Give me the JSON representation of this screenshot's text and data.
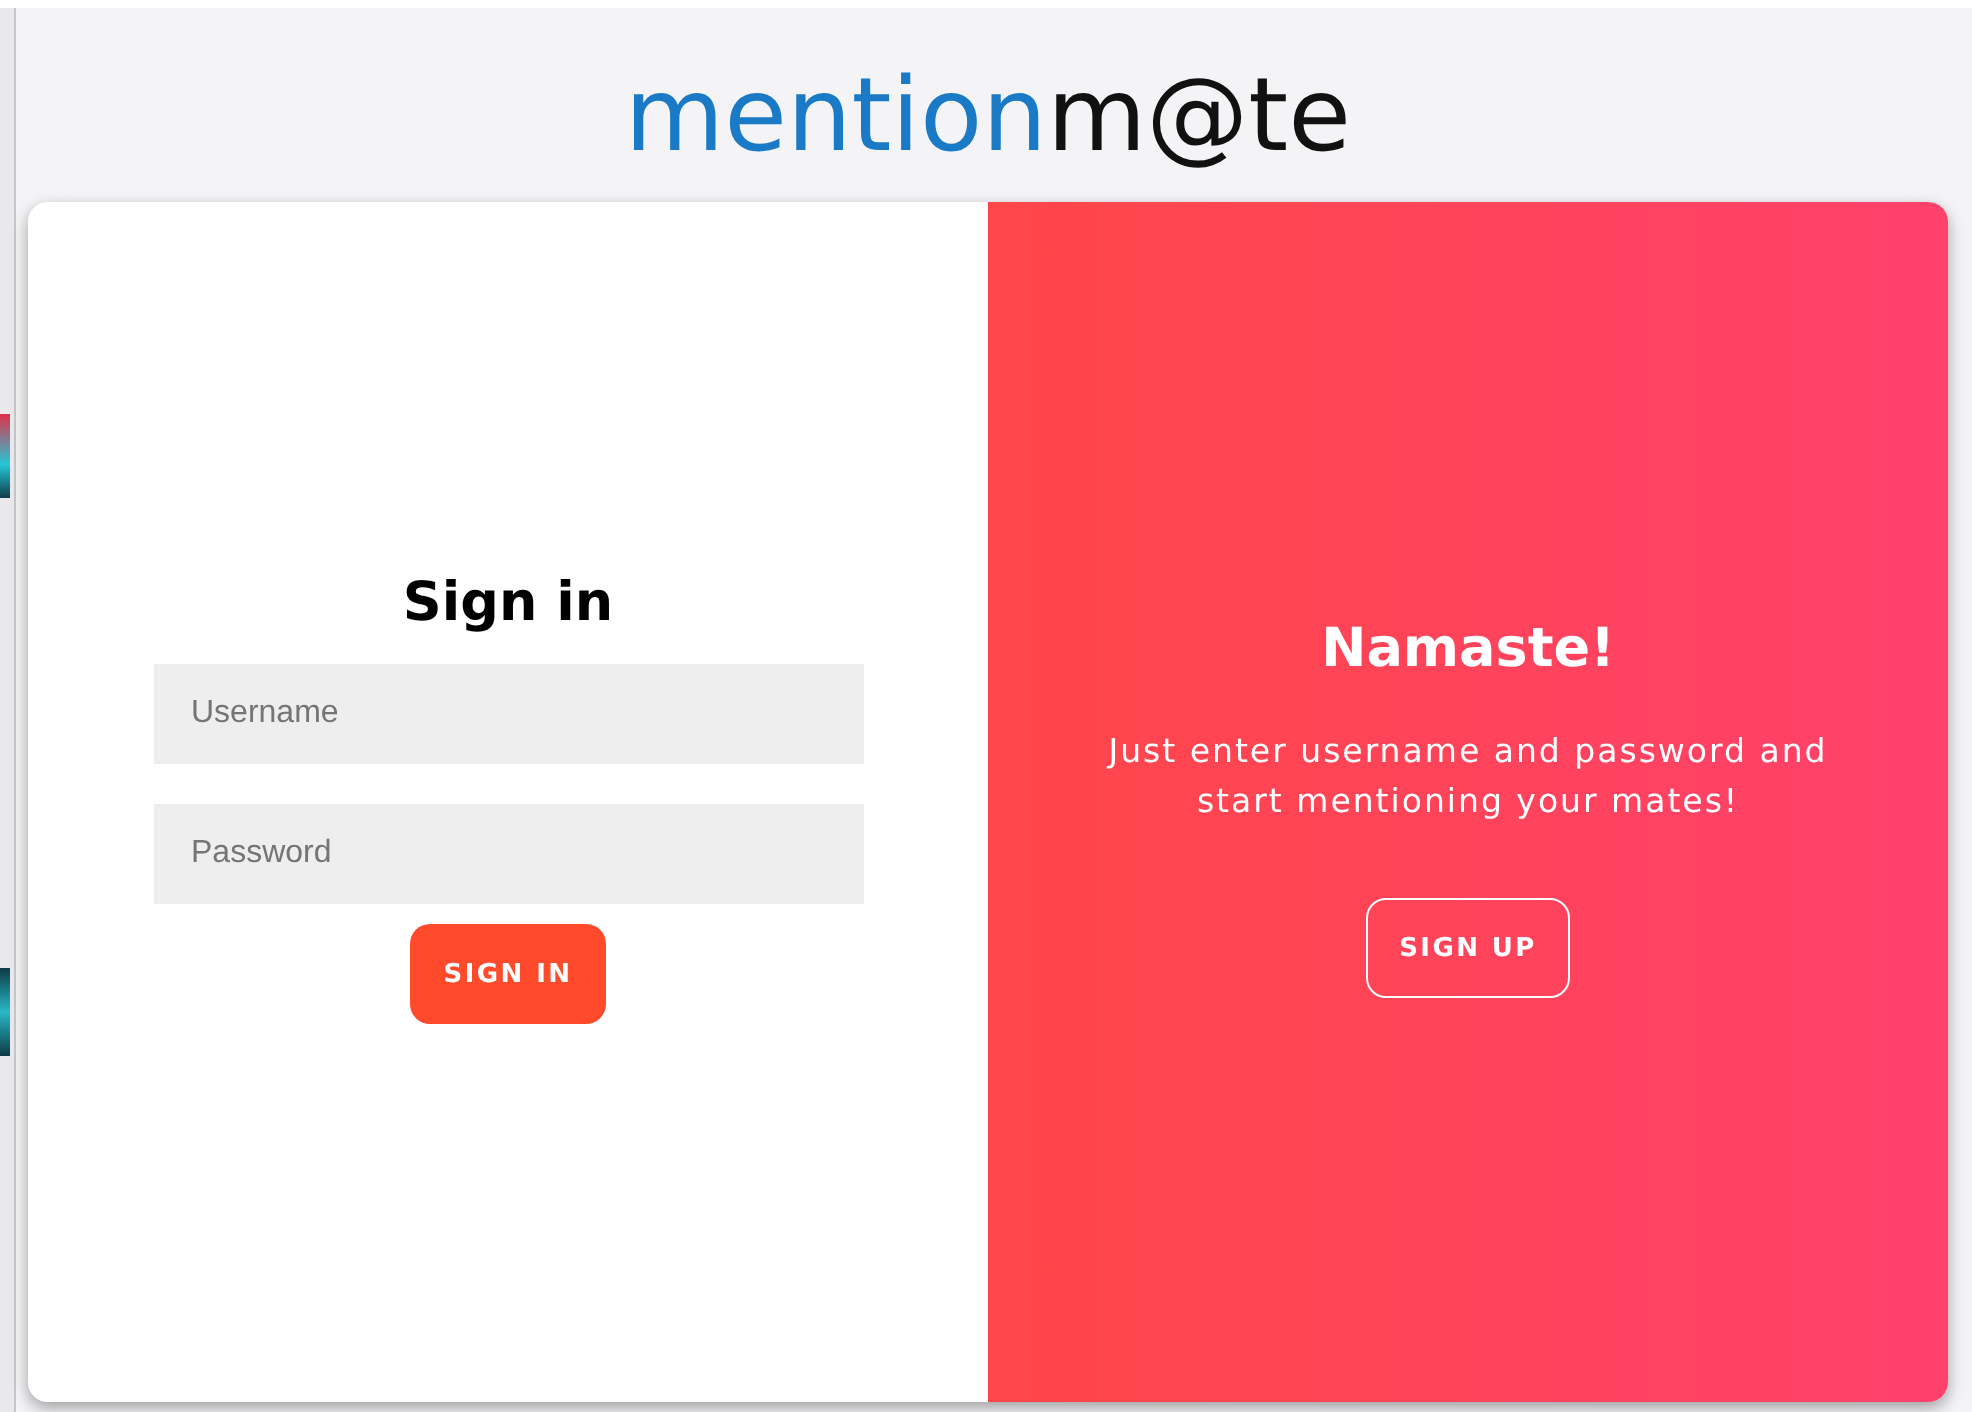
{
  "logo": {
    "part_1": "mention",
    "part_2": "m@te"
  },
  "sign_in": {
    "title": "Sign in",
    "fields": [
      {
        "placeholder": "Username"
      },
      {
        "placeholder": "Password"
      }
    ],
    "button": "SIGN IN"
  },
  "welcome": {
    "title": "Namaste!",
    "message": "Just enter username and password and start mentioning your mates!",
    "button": "SIGN UP"
  }
}
